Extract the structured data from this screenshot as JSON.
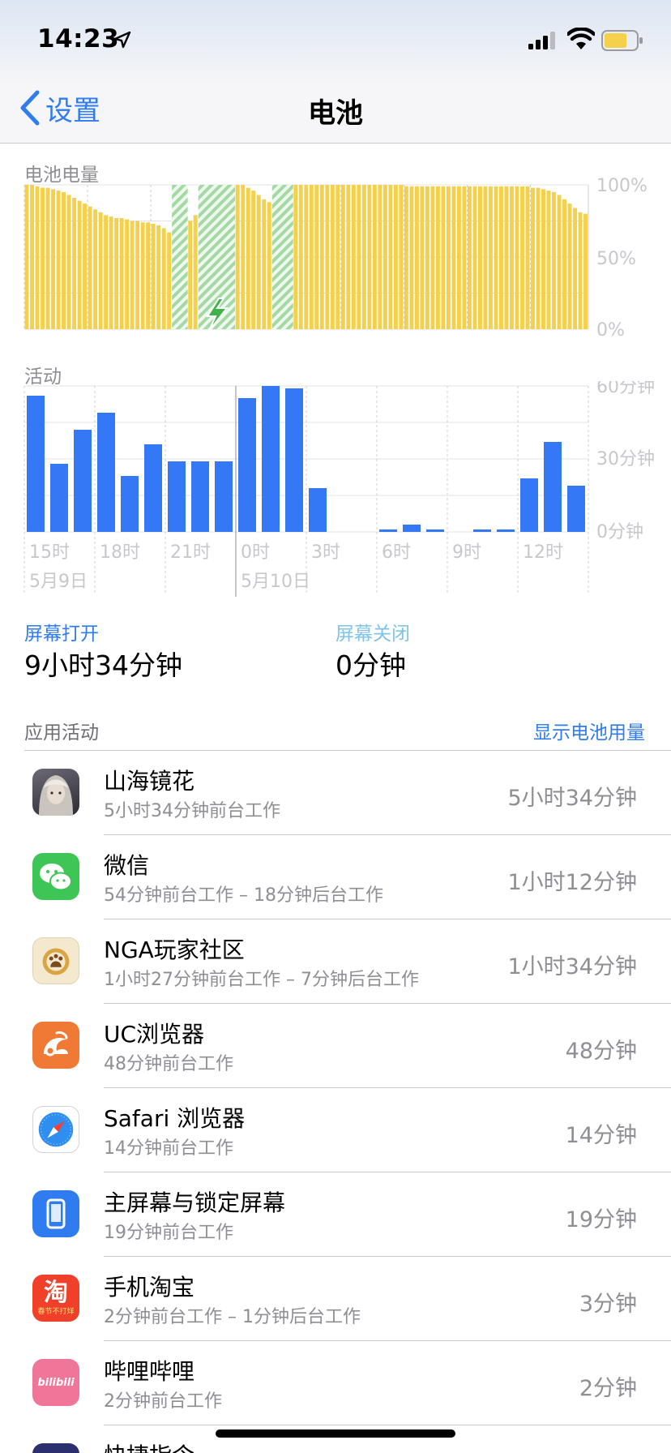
{
  "status_bar": {
    "time": "14:23",
    "icons": [
      "location-arrow-icon",
      "cellular-signal-icon",
      "wifi-icon",
      "battery-icon"
    ],
    "battery_level": 0.8,
    "battery_color": "#f5d04a"
  },
  "nav": {
    "back_label": "设置",
    "title": "电池"
  },
  "battery_chart": {
    "label": "电池电量",
    "y_ticks": [
      "100%",
      "50%",
      "0%"
    ]
  },
  "activity_chart": {
    "label": "活动",
    "y_ticks": [
      "60分钟",
      "30分钟",
      "0分钟"
    ],
    "x_ticks": [
      "15时",
      "18时",
      "21时",
      "0时",
      "3时",
      "6时",
      "9时",
      "12时"
    ],
    "date_labels": [
      "5月9日",
      "5月10日"
    ]
  },
  "chart_data": [
    {
      "type": "bar",
      "title": "电池电量",
      "ylim": [
        0,
        100
      ],
      "y_unit": "%",
      "y_ticks": [
        0,
        50,
        100
      ],
      "values": [
        100,
        100,
        99,
        98,
        98,
        97,
        96,
        95,
        93,
        91,
        89,
        87,
        85,
        83,
        81,
        79,
        78,
        77,
        77,
        76,
        75,
        75,
        74,
        74,
        73,
        72,
        70,
        67,
        64,
        65,
        70,
        75,
        79,
        83,
        86,
        89,
        91,
        93,
        94,
        95,
        100,
        100,
        98,
        96,
        93,
        90,
        88,
        91,
        95,
        98,
        100,
        100,
        100,
        100,
        100,
        100,
        100,
        100,
        100,
        100,
        100,
        100,
        100,
        100,
        100,
        100,
        100,
        100,
        100,
        100,
        100,
        100,
        99,
        99,
        99,
        99,
        99,
        99,
        99,
        99,
        99,
        99,
        99,
        99,
        99,
        99,
        99,
        99,
        99,
        99,
        99,
        99,
        99,
        99,
        99,
        99,
        98,
        98,
        97,
        96,
        95,
        93,
        90,
        87,
        84,
        81,
        80
      ],
      "charging_periods": [
        {
          "start_index": 28,
          "end_index": 30
        },
        {
          "start_index": 33,
          "end_index": 39
        },
        {
          "start_index": 47,
          "end_index": 50
        }
      ],
      "charging_icon": "lightning-bolt-icon",
      "colors": {
        "level": "#f5d04a",
        "charging": "#a4d9a4"
      }
    },
    {
      "type": "bar",
      "title": "活动",
      "y_unit": "分钟",
      "ylim": [
        0,
        60
      ],
      "y_ticks": [
        0,
        30,
        60
      ],
      "x_ticks": [
        "15时",
        "18时",
        "21时",
        "0时",
        "3时",
        "6时",
        "9时",
        "12时"
      ],
      "values": [
        56,
        28,
        42,
        49,
        23,
        36,
        29,
        29,
        29,
        55,
        60,
        59,
        18,
        0,
        0,
        1,
        3,
        1,
        0,
        1,
        1,
        22,
        37,
        19
      ],
      "colors": {
        "bar": "#3478f6"
      }
    }
  ],
  "screen": {
    "on_label": "屏幕打开",
    "on_value": "9小时34分钟",
    "off_label": "屏幕关闭",
    "off_value": "0分钟",
    "on_color": "#2f7bf0",
    "off_color": "#7fc3e8"
  },
  "app_activity": {
    "header": "应用活动",
    "show_usage_link": "显示电池用量",
    "apps": [
      {
        "name": "山海镜花",
        "detail": "5小时34分钟前台工作",
        "duration": "5小时34分钟",
        "icon": "shanhaijinghua-app-icon"
      },
      {
        "name": "微信",
        "detail": "54分钟前台工作 – 18分钟后台工作",
        "duration": "1小时12分钟",
        "icon": "wechat-app-icon"
      },
      {
        "name": "NGA玩家社区",
        "detail": "1小时27分钟前台工作 – 7分钟后台工作",
        "duration": "1小时34分钟",
        "icon": "nga-app-icon"
      },
      {
        "name": "UC浏览器",
        "detail": "48分钟前台工作",
        "duration": "48分钟",
        "icon": "uc-browser-app-icon"
      },
      {
        "name": "Safari 浏览器",
        "detail": "14分钟前台工作",
        "duration": "14分钟",
        "icon": "safari-app-icon"
      },
      {
        "name": "主屏幕与锁定屏幕",
        "detail": "19分钟前台工作",
        "duration": "19分钟",
        "icon": "home-lock-screen-app-icon"
      },
      {
        "name": "手机淘宝",
        "detail": "2分钟前台工作 – 1分钟后台工作",
        "duration": "3分钟",
        "icon": "taobao-app-icon",
        "icon_text": "淘",
        "icon_subtext": "春节不打烊"
      },
      {
        "name": "哔哩哔哩",
        "detail": "2分钟前台工作",
        "duration": "2分钟",
        "icon": "bilibili-app-icon",
        "icon_text": "bilibili"
      },
      {
        "name": "快捷指令",
        "detail": "",
        "duration": "",
        "icon": "shortcuts-app-icon"
      }
    ]
  }
}
